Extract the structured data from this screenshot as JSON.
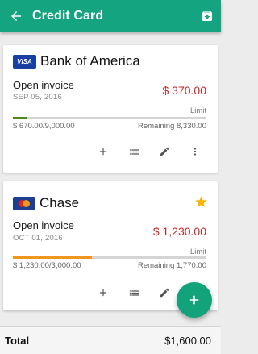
{
  "appbar": {
    "title": "Credit Card",
    "back_icon": "arrow-back-icon",
    "archive_icon": "archive-icon",
    "color": "#14a47f"
  },
  "cards": [
    {
      "bank": "Bank of America",
      "logo": "visa-logo",
      "logo_text": "VISA",
      "invoice_label": "Open invoice",
      "invoice_date": "SEP 05, 2016",
      "invoice_amount": "$ 370.00",
      "limit_label": "Limit",
      "used": "$ 670.00/9,000.00",
      "remaining": "Remaining 8,330.00",
      "progress_fraction": 0.074,
      "progress_color": "#4c8c1a",
      "favorite": false
    },
    {
      "bank": "Chase",
      "logo": "mastercard-logo",
      "invoice_label": "Open invoice",
      "invoice_date": "OCT 01, 2016",
      "invoice_amount": "$ 1,230.00",
      "limit_label": "Limit",
      "used": "$ 1,230.00/3,000.00",
      "remaining": "Remaining 1,770.00",
      "progress_fraction": 0.41,
      "progress_color": "#f0961e",
      "favorite": true
    }
  ],
  "card_actions": [
    "add-icon",
    "list-icon",
    "edit-icon",
    "more-vert-icon"
  ],
  "fab": {
    "icon": "add-icon",
    "color": "#13a37b"
  },
  "footer": {
    "total_label": "Total",
    "total_value": "$1,600.00"
  },
  "colors": {
    "amount": "#c62828",
    "star": "#f7b500"
  }
}
